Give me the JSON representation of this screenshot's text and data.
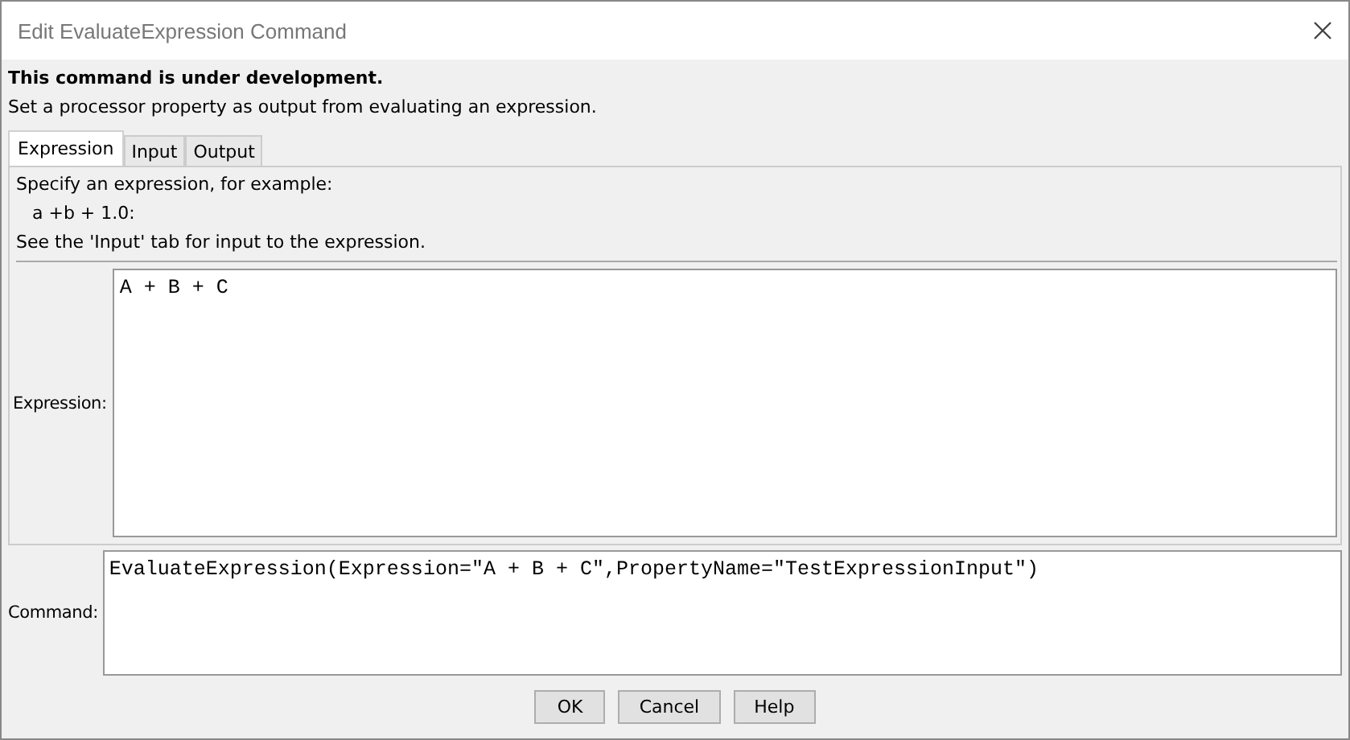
{
  "window": {
    "title": "Edit EvaluateExpression Command"
  },
  "notice": "This command is under development.",
  "description": "Set a processor property as output from evaluating an expression.",
  "tabs": [
    {
      "label": "Expression",
      "selected": true
    },
    {
      "label": "Input",
      "selected": false
    },
    {
      "label": "Output",
      "selected": false
    }
  ],
  "tab_help": [
    "Specify an expression, for example:",
    "a +b + 1.0:",
    "See the 'Input' tab for input to the expression."
  ],
  "expression": {
    "label": "Expression:",
    "value": "A + B + C"
  },
  "command": {
    "label": "Command:",
    "value": "EvaluateExpression(Expression=\"A + B + C\",PropertyName=\"TestExpressionInput\")"
  },
  "buttons": [
    "OK",
    "Cancel",
    "Help"
  ]
}
